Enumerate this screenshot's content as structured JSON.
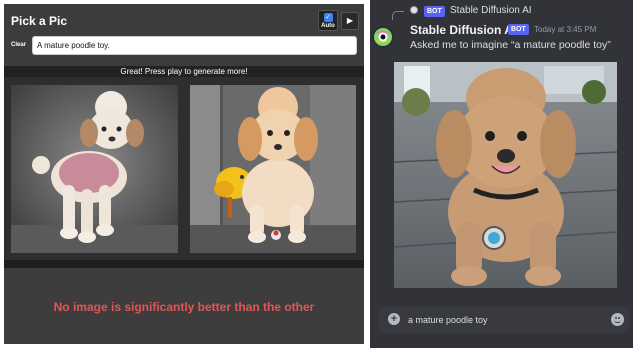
{
  "pickapic": {
    "title": "Pick a Pic",
    "auto_label": "Auto",
    "play_icon": "play-icon",
    "clear_label": "Clear",
    "prompt_value": "A mature poodle toy.",
    "status": "Great! Press play to generate more!",
    "verdict": "No image is significantly better than the other",
    "verdict_color": "#e25555"
  },
  "discord": {
    "reply": {
      "tag": "BOT",
      "name": "Stable Diffusion AI"
    },
    "message": {
      "author": "Stable Diffusion AI",
      "tag": "BOT",
      "timestamp": "Today at 3:45 PM",
      "text": "Asked me to imagine “a mature poodle toy”"
    },
    "input_value": "a mature poodle toy",
    "bot_tag_color": "#5865f2"
  }
}
